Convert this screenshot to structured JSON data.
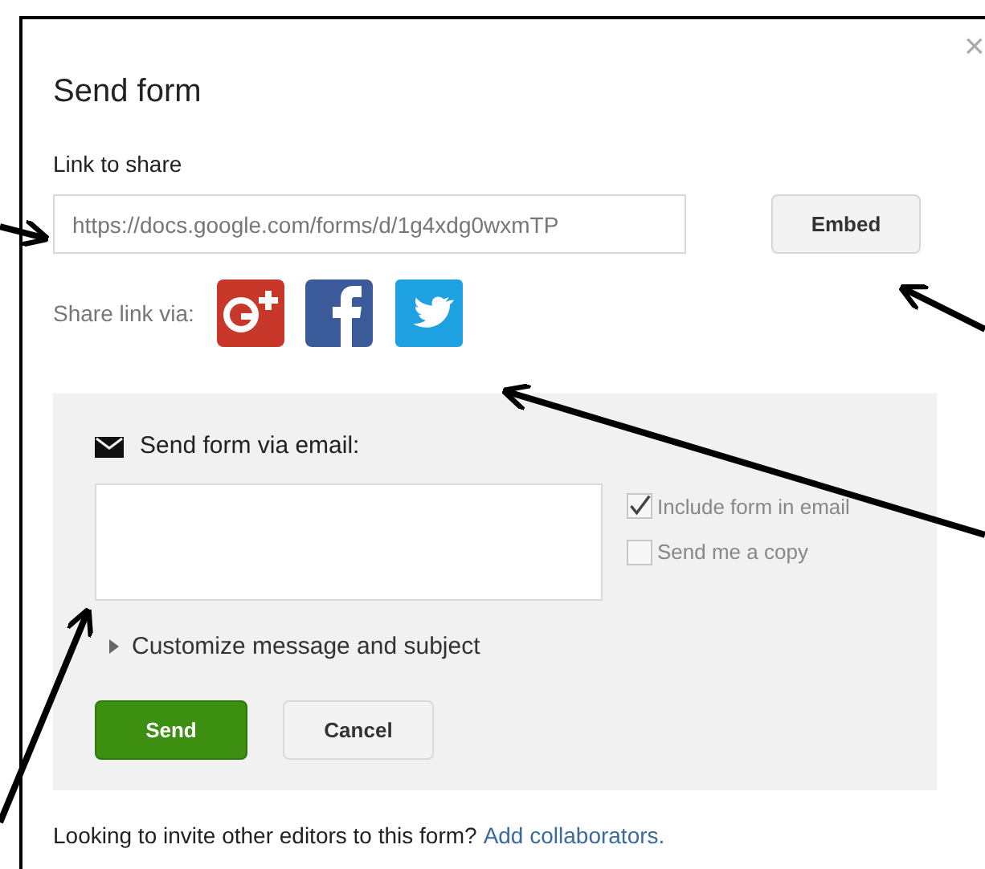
{
  "dialog": {
    "title": "Send form",
    "close": "×"
  },
  "link": {
    "label": "Link to share",
    "value": "https://docs.google.com/forms/d/1g4xdg0wxmTP",
    "embed_button": "Embed"
  },
  "share": {
    "label": "Share link via:"
  },
  "email": {
    "heading": "Send form via email:",
    "options": [
      {
        "label": "Include form in email",
        "checked": true
      },
      {
        "label": "Send me a copy",
        "checked": false
      }
    ],
    "customize": {
      "label": "Customize message and subject",
      "expanded": false
    },
    "send_button": "Send",
    "cancel_button": "Cancel"
  },
  "footer": {
    "text": "Looking to invite other editors to this form?",
    "link": "Add collaborators."
  }
}
